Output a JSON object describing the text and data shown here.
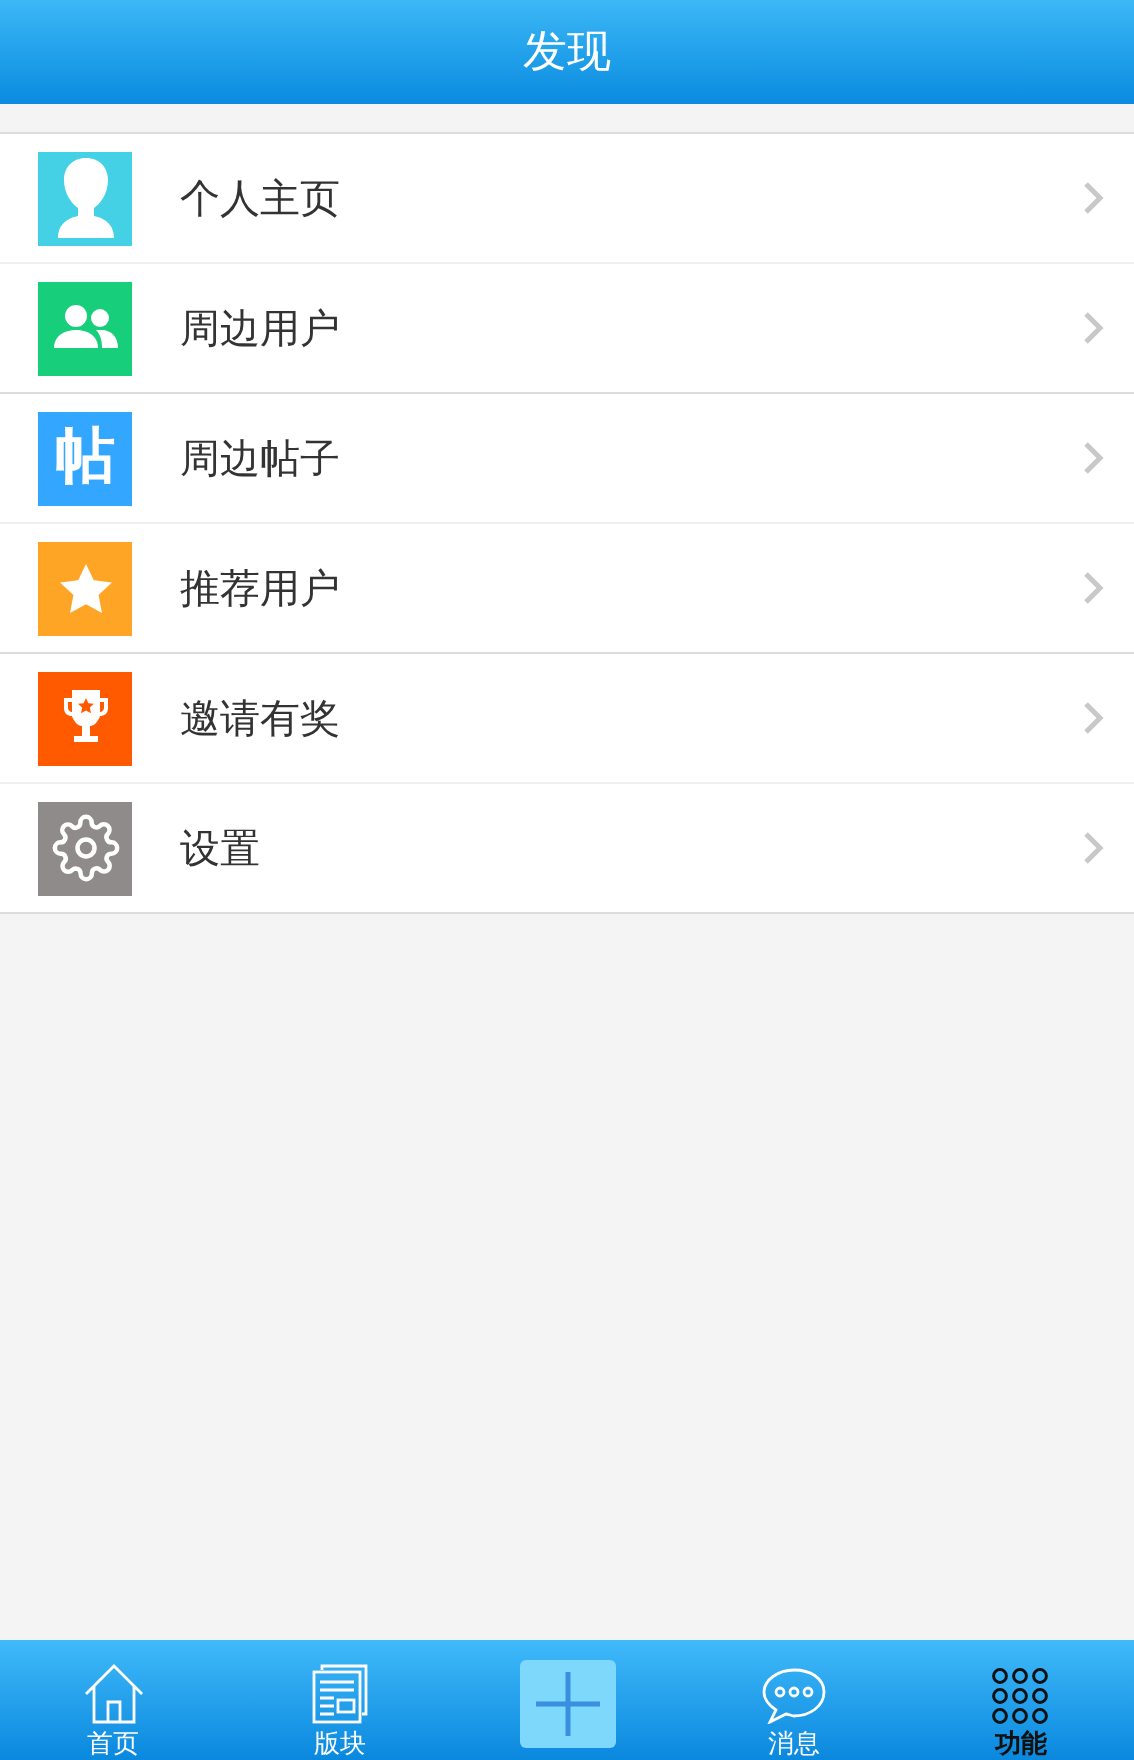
{
  "header": {
    "title": "发现"
  },
  "groups": [
    {
      "items": [
        {
          "kind": "profile",
          "label": "个人主页",
          "color": "#44d1e6"
        },
        {
          "kind": "users",
          "label": "周边用户",
          "color": "#17cf7a"
        }
      ]
    },
    {
      "items": [
        {
          "kind": "glyph",
          "glyph": "帖",
          "label": "周边帖子",
          "color": "#33a6ff"
        },
        {
          "kind": "star",
          "label": "推荐用户",
          "color": "#ffa526"
        }
      ]
    },
    {
      "items": [
        {
          "kind": "trophy",
          "label": "邀请有奖",
          "color": "#ff5a00"
        },
        {
          "kind": "gear",
          "label": "设置",
          "color": "#8e8b8a"
        }
      ]
    }
  ],
  "tabs": [
    {
      "kind": "home",
      "label": "首页",
      "selected": false
    },
    {
      "kind": "boards",
      "label": "版块",
      "selected": false
    },
    {
      "kind": "plus",
      "selected": false
    },
    {
      "kind": "chat",
      "label": "消息",
      "selected": false
    },
    {
      "kind": "grid",
      "label": "功能",
      "selected": true
    }
  ]
}
